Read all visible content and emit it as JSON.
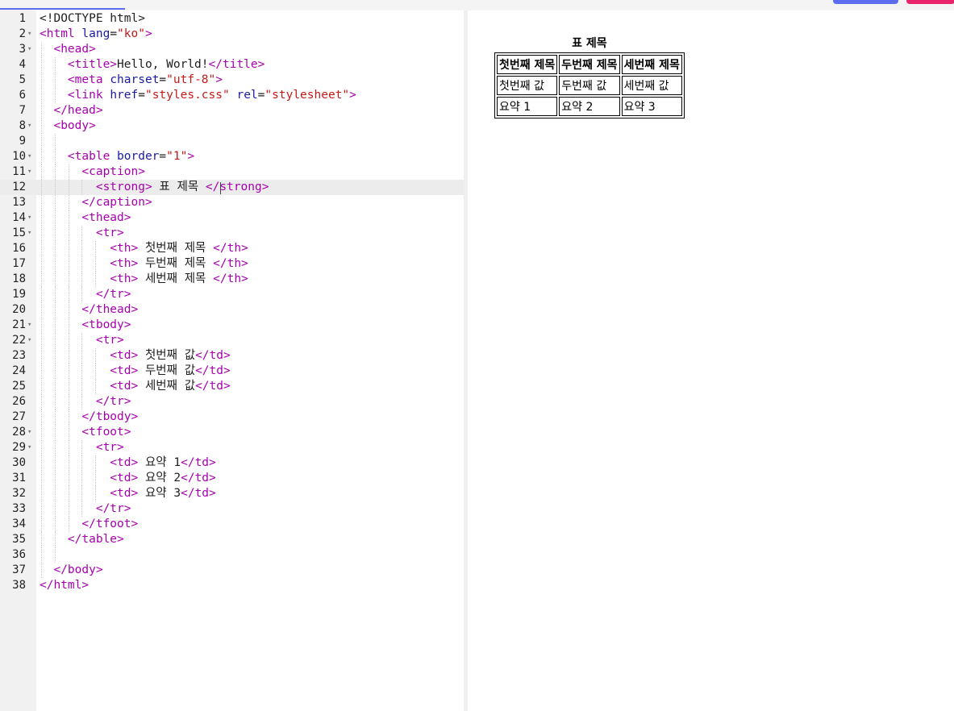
{
  "editor": {
    "lines": [
      {
        "n": "1",
        "fold": false,
        "depth": 0,
        "tokens": [
          [
            "x",
            "<!DOCTYPE html>"
          ]
        ]
      },
      {
        "n": "2",
        "fold": true,
        "depth": 0,
        "tokens": [
          [
            "t",
            "<html "
          ],
          [
            "a",
            "lang"
          ],
          [
            "x",
            "="
          ],
          [
            "s",
            "\"ko\""
          ],
          [
            "t",
            ">"
          ]
        ]
      },
      {
        "n": "3",
        "fold": true,
        "depth": 1,
        "tokens": [
          [
            "x",
            "  "
          ],
          [
            "t",
            "<head>"
          ]
        ]
      },
      {
        "n": "4",
        "fold": false,
        "depth": 2,
        "tokens": [
          [
            "x",
            "    "
          ],
          [
            "t",
            "<title>"
          ],
          [
            "x",
            "Hello, World!"
          ],
          [
            "t",
            "</title>"
          ]
        ]
      },
      {
        "n": "5",
        "fold": false,
        "depth": 2,
        "tokens": [
          [
            "x",
            "    "
          ],
          [
            "t",
            "<meta "
          ],
          [
            "a",
            "charset"
          ],
          [
            "x",
            "="
          ],
          [
            "s",
            "\"utf-8\""
          ],
          [
            "t",
            ">"
          ]
        ]
      },
      {
        "n": "6",
        "fold": false,
        "depth": 2,
        "tokens": [
          [
            "x",
            "    "
          ],
          [
            "t",
            "<link "
          ],
          [
            "a",
            "href"
          ],
          [
            "x",
            "="
          ],
          [
            "s",
            "\"styles.css\""
          ],
          [
            "x",
            " "
          ],
          [
            "a",
            "rel"
          ],
          [
            "x",
            "="
          ],
          [
            "s",
            "\"stylesheet\""
          ],
          [
            "t",
            ">"
          ]
        ]
      },
      {
        "n": "7",
        "fold": false,
        "depth": 1,
        "tokens": [
          [
            "x",
            "  "
          ],
          [
            "t",
            "</head>"
          ]
        ]
      },
      {
        "n": "8",
        "fold": true,
        "depth": 1,
        "tokens": [
          [
            "x",
            "  "
          ],
          [
            "t",
            "<body>"
          ]
        ]
      },
      {
        "n": "9",
        "fold": false,
        "depth": 2,
        "tokens": []
      },
      {
        "n": "10",
        "fold": true,
        "depth": 2,
        "tokens": [
          [
            "x",
            "    "
          ],
          [
            "t",
            "<table "
          ],
          [
            "a",
            "border"
          ],
          [
            "x",
            "="
          ],
          [
            "s",
            "\"1\""
          ],
          [
            "t",
            ">"
          ]
        ]
      },
      {
        "n": "11",
        "fold": true,
        "depth": 3,
        "tokens": [
          [
            "x",
            "      "
          ],
          [
            "t",
            "<caption>"
          ]
        ]
      },
      {
        "n": "12",
        "fold": false,
        "depth": 4,
        "active": true,
        "cursor_ch": 26,
        "tokens": [
          [
            "x",
            "        "
          ],
          [
            "t",
            "<strong>"
          ],
          [
            "x",
            " 표 제목 "
          ],
          [
            "t",
            "</strong>"
          ]
        ]
      },
      {
        "n": "13",
        "fold": false,
        "depth": 3,
        "tokens": [
          [
            "x",
            "      "
          ],
          [
            "t",
            "</caption>"
          ]
        ]
      },
      {
        "n": "14",
        "fold": true,
        "depth": 3,
        "tokens": [
          [
            "x",
            "      "
          ],
          [
            "t",
            "<thead>"
          ]
        ]
      },
      {
        "n": "15",
        "fold": true,
        "depth": 4,
        "tokens": [
          [
            "x",
            "        "
          ],
          [
            "t",
            "<tr>"
          ]
        ]
      },
      {
        "n": "16",
        "fold": false,
        "depth": 5,
        "tokens": [
          [
            "x",
            "          "
          ],
          [
            "t",
            "<th>"
          ],
          [
            "x",
            " 첫번째 제목 "
          ],
          [
            "t",
            "</th>"
          ]
        ]
      },
      {
        "n": "17",
        "fold": false,
        "depth": 5,
        "tokens": [
          [
            "x",
            "          "
          ],
          [
            "t",
            "<th>"
          ],
          [
            "x",
            " 두번째 제목 "
          ],
          [
            "t",
            "</th>"
          ]
        ]
      },
      {
        "n": "18",
        "fold": false,
        "depth": 5,
        "tokens": [
          [
            "x",
            "          "
          ],
          [
            "t",
            "<th>"
          ],
          [
            "x",
            " 세번째 제목 "
          ],
          [
            "t",
            "</th>"
          ]
        ]
      },
      {
        "n": "19",
        "fold": false,
        "depth": 4,
        "tokens": [
          [
            "x",
            "        "
          ],
          [
            "t",
            "</tr>"
          ]
        ]
      },
      {
        "n": "20",
        "fold": false,
        "depth": 3,
        "tokens": [
          [
            "x",
            "      "
          ],
          [
            "t",
            "</thead>"
          ]
        ]
      },
      {
        "n": "21",
        "fold": true,
        "depth": 3,
        "tokens": [
          [
            "x",
            "      "
          ],
          [
            "t",
            "<tbody>"
          ]
        ]
      },
      {
        "n": "22",
        "fold": true,
        "depth": 4,
        "tokens": [
          [
            "x",
            "        "
          ],
          [
            "t",
            "<tr>"
          ]
        ]
      },
      {
        "n": "23",
        "fold": false,
        "depth": 5,
        "tokens": [
          [
            "x",
            "          "
          ],
          [
            "t",
            "<td>"
          ],
          [
            "x",
            " 첫번째 값"
          ],
          [
            "t",
            "</td>"
          ]
        ]
      },
      {
        "n": "24",
        "fold": false,
        "depth": 5,
        "tokens": [
          [
            "x",
            "          "
          ],
          [
            "t",
            "<td>"
          ],
          [
            "x",
            " 두번째 값"
          ],
          [
            "t",
            "</td>"
          ]
        ]
      },
      {
        "n": "25",
        "fold": false,
        "depth": 5,
        "tokens": [
          [
            "x",
            "          "
          ],
          [
            "t",
            "<td>"
          ],
          [
            "x",
            " 세번째 값"
          ],
          [
            "t",
            "</td>"
          ]
        ]
      },
      {
        "n": "26",
        "fold": false,
        "depth": 4,
        "tokens": [
          [
            "x",
            "        "
          ],
          [
            "t",
            "</tr>"
          ]
        ]
      },
      {
        "n": "27",
        "fold": false,
        "depth": 3,
        "tokens": [
          [
            "x",
            "      "
          ],
          [
            "t",
            "</tbody>"
          ]
        ]
      },
      {
        "n": "28",
        "fold": true,
        "depth": 3,
        "tokens": [
          [
            "x",
            "      "
          ],
          [
            "t",
            "<tfoot>"
          ]
        ]
      },
      {
        "n": "29",
        "fold": true,
        "depth": 4,
        "tokens": [
          [
            "x",
            "        "
          ],
          [
            "t",
            "<tr>"
          ]
        ]
      },
      {
        "n": "30",
        "fold": false,
        "depth": 5,
        "tokens": [
          [
            "x",
            "          "
          ],
          [
            "t",
            "<td>"
          ],
          [
            "x",
            " 요약 1"
          ],
          [
            "t",
            "</td>"
          ]
        ]
      },
      {
        "n": "31",
        "fold": false,
        "depth": 5,
        "tokens": [
          [
            "x",
            "          "
          ],
          [
            "t",
            "<td>"
          ],
          [
            "x",
            " 요약 2"
          ],
          [
            "t",
            "</td>"
          ]
        ]
      },
      {
        "n": "32",
        "fold": false,
        "depth": 5,
        "tokens": [
          [
            "x",
            "          "
          ],
          [
            "t",
            "<td>"
          ],
          [
            "x",
            " 요약 3"
          ],
          [
            "t",
            "</td>"
          ]
        ]
      },
      {
        "n": "33",
        "fold": false,
        "depth": 4,
        "tokens": [
          [
            "x",
            "        "
          ],
          [
            "t",
            "</tr>"
          ]
        ]
      },
      {
        "n": "34",
        "fold": false,
        "depth": 3,
        "tokens": [
          [
            "x",
            "      "
          ],
          [
            "t",
            "</tfoot>"
          ]
        ]
      },
      {
        "n": "35",
        "fold": false,
        "depth": 2,
        "tokens": [
          [
            "x",
            "    "
          ],
          [
            "t",
            "</table>"
          ]
        ]
      },
      {
        "n": "36",
        "fold": false,
        "depth": 2,
        "tokens": []
      },
      {
        "n": "37",
        "fold": false,
        "depth": 1,
        "tokens": [
          [
            "x",
            "  "
          ],
          [
            "t",
            "</body>"
          ]
        ]
      },
      {
        "n": "38",
        "fold": false,
        "depth": 0,
        "tokens": [
          [
            "t",
            "</html>"
          ]
        ]
      }
    ]
  },
  "preview": {
    "caption": "표 제목",
    "headers": [
      "첫번째 제목",
      "두번째 제목",
      "세번째 제목"
    ],
    "body_row": [
      "첫번째 값",
      "두번째 값",
      "세번째 값"
    ],
    "foot_row": [
      "요약 1",
      "요약 2",
      "요약 3"
    ]
  },
  "colors": {
    "tag": "#a700b0",
    "attribute": "#1a1aa6",
    "string": "#c41a16",
    "accent_blue": "#5b6cf0",
    "accent_pink": "#e8246a"
  }
}
